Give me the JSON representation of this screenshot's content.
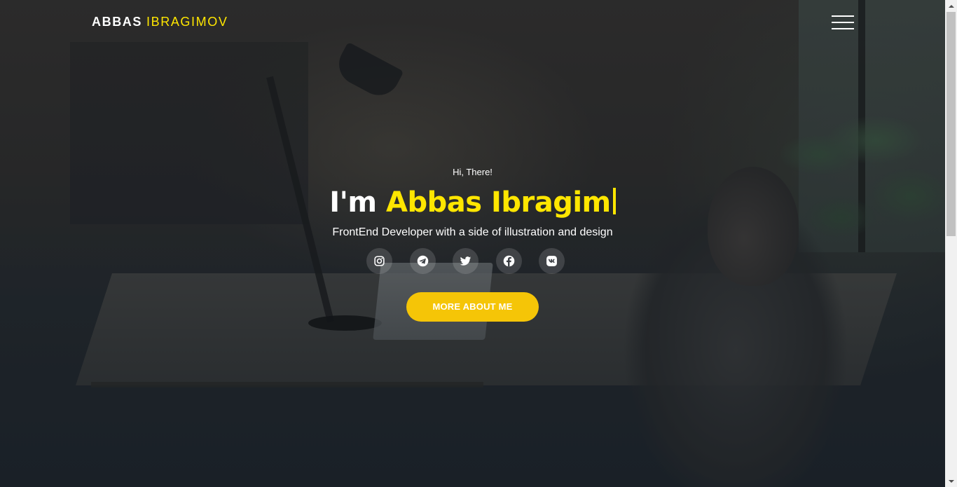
{
  "header": {
    "brand_first": "ABBAS",
    "brand_last": "IBRAGIMOV",
    "menu_icon": "hamburger-menu-icon"
  },
  "hero": {
    "greeting": "Hi, There!",
    "headline_prefix": "I'm",
    "headline_name": "Abbas Ibragim",
    "tagline": "FrontEnd Developer with a side of illustration and design",
    "cta_label": "MORE ABOUT ME"
  },
  "socials": [
    {
      "icon": "instagram-icon"
    },
    {
      "icon": "telegram-icon"
    },
    {
      "icon": "twitter-icon"
    },
    {
      "icon": "facebook-icon"
    },
    {
      "icon": "vk-icon"
    }
  ],
  "colors": {
    "accent": "#ffe600",
    "button": "#f5c507",
    "text": "#ffffff",
    "background": "#1f262e"
  }
}
